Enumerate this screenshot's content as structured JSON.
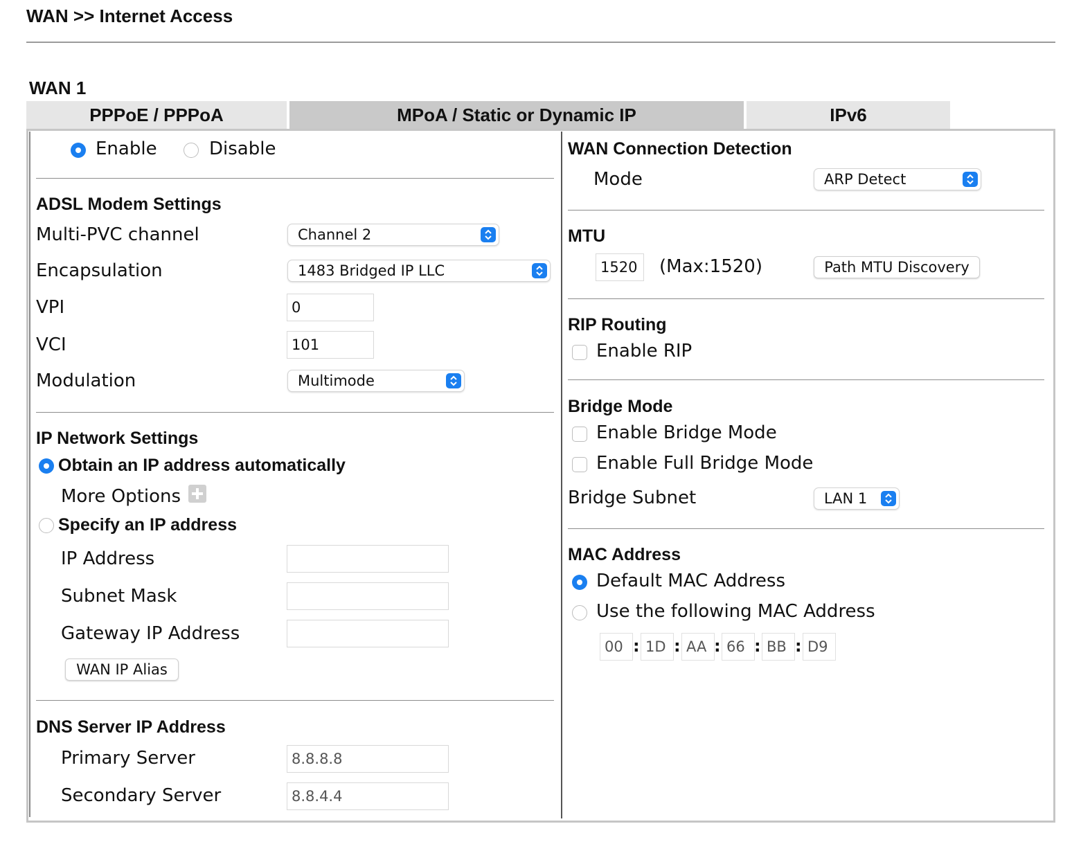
{
  "header": {
    "title": "WAN >> Internet Access"
  },
  "wan_label": "WAN 1",
  "tabs": [
    {
      "label": "PPPoE / PPPoA",
      "active": false
    },
    {
      "label": "MPoA / Static or Dynamic IP",
      "active": true
    },
    {
      "label": "IPv6",
      "active": false
    }
  ],
  "status": {
    "enable": "Enable",
    "disable": "Disable",
    "selected": "Enable"
  },
  "adsl": {
    "title": "ADSL Modem Settings",
    "multi_pvc_label": "Multi-PVC channel",
    "multi_pvc_value": "Channel 2",
    "encapsulation_label": "Encapsulation",
    "encapsulation_value": "1483 Bridged IP LLC",
    "vpi_label": "VPI",
    "vpi_value": "0",
    "vci_label": "VCI",
    "vci_value": "101",
    "modulation_label": "Modulation",
    "modulation_value": "Multimode"
  },
  "ip_network": {
    "title": "IP Network Settings",
    "obtain_auto": "Obtain an IP address automatically",
    "more_options": "More Options",
    "specify": "Specify an IP address",
    "ip_address_label": "IP Address",
    "ip_address_value": "",
    "subnet_mask_label": "Subnet Mask",
    "subnet_mask_value": "",
    "gateway_label": "Gateway IP Address",
    "gateway_value": "",
    "wan_ip_alias": "WAN IP Alias"
  },
  "dns": {
    "title": "DNS Server IP Address",
    "primary_label": "Primary Server",
    "primary_value": "8.8.8.8",
    "secondary_label": "Secondary Server",
    "secondary_value": "8.8.4.4"
  },
  "detection": {
    "title": "WAN Connection Detection",
    "mode_label": "Mode",
    "mode_value": "ARP Detect"
  },
  "mtu": {
    "title": "MTU",
    "value": "1520",
    "max_text": "(Max:1520)",
    "path_mtu_button": "Path MTU Discovery"
  },
  "rip": {
    "title": "RIP Routing",
    "enable_rip": "Enable RIP"
  },
  "bridge": {
    "title": "Bridge Mode",
    "enable_bridge": "Enable Bridge Mode",
    "enable_full_bridge": "Enable Full Bridge Mode",
    "subnet_label": "Bridge Subnet",
    "subnet_value": "LAN 1"
  },
  "mac": {
    "title": "MAC Address",
    "default_label": "Default MAC Address",
    "custom_label": "Use the following MAC Address",
    "octets": [
      "00",
      "1D",
      "AA",
      "66",
      "BB",
      "D9"
    ]
  },
  "colors": {
    "accent": "#1a7ff0",
    "tab_active": "#c9c9c9",
    "tab_inactive": "#e6e6e6"
  }
}
